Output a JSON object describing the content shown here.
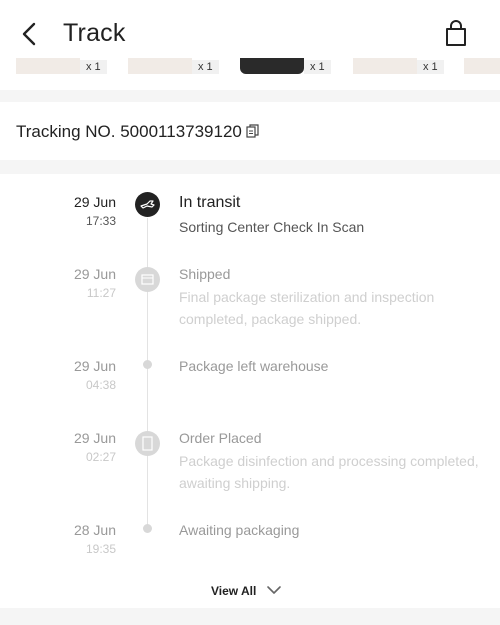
{
  "header": {
    "title": "Track"
  },
  "items": [
    {
      "qty": "x 1"
    },
    {
      "qty": "x 1"
    },
    {
      "qty": "x 1"
    },
    {
      "qty": "x 1"
    }
  ],
  "tracking": {
    "label": "Tracking NO. 5000113739120"
  },
  "timeline": [
    {
      "date": "29 Jun",
      "time": "17:33",
      "title": "In transit",
      "desc": "Sorting Center Check In Scan",
      "icon": "plane-icon"
    },
    {
      "date": "29 Jun",
      "time": "11:27",
      "title": "Shipped",
      "desc": "Final package sterilization and inspection completed, package shipped.",
      "icon": "box-icon"
    },
    {
      "date": "29 Jun",
      "time": "04:38",
      "title": "Package left warehouse",
      "desc": "",
      "icon": "dot"
    },
    {
      "date": "29 Jun",
      "time": "02:27",
      "title": "Order Placed",
      "desc": "Package disinfection and processing completed, awaiting shipping.",
      "icon": "document-icon"
    },
    {
      "date": "28 Jun",
      "time": "19:35",
      "title": "Awaiting packaging",
      "desc": "",
      "icon": "dot"
    }
  ],
  "footer": {
    "view_all": "View All"
  }
}
